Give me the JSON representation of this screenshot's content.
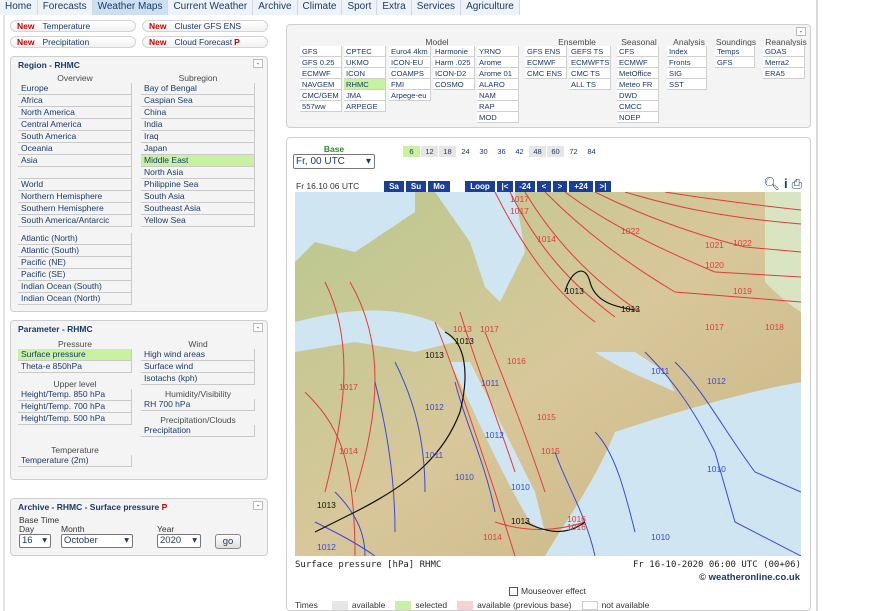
{
  "nav": [
    "Home",
    "Forecasts",
    "Weather Maps",
    "Current Weather",
    "Archive",
    "Climate",
    "Sport",
    "Extra",
    "Services",
    "Agriculture"
  ],
  "quick": [
    {
      "new": "New",
      "label": "Temperature"
    },
    {
      "new": "New",
      "label": "Cluster GFS ENS"
    },
    {
      "new": "New",
      "label": "Precipitation"
    },
    {
      "new": "New",
      "label": "Cloud Forecast",
      "p": "P"
    }
  ],
  "region": {
    "title": "Region - RHMC",
    "overview_title": "Overview",
    "subregion_title": "Subregion",
    "overview": [
      "Europe",
      "Africa",
      "North America",
      "Central America",
      "South America",
      "Oceania",
      "Asia",
      "",
      "World",
      "Northern Hemisphere",
      "Southern Hemisphere",
      "South America/Antarcic"
    ],
    "oceans": [
      "Atlantic (North)",
      "Atlantic (South)",
      "Pacific (NE)",
      "Pacific (SE)",
      "Indian Ocean (South)",
      "Indian Ocean (North)"
    ],
    "subregion": [
      "Bay of Bengal",
      "Caspian Sea",
      "China",
      "India",
      "Iraq",
      "Japan",
      "Middle East",
      "North Asia",
      "Philippine Sea",
      "South Asia",
      "Southeast Asia",
      "Yellow Sea"
    ],
    "selected_sub": "Middle East"
  },
  "parameter": {
    "title": "Parameter - RHMC",
    "pressure_title": "Pressure",
    "pressure": [
      "Surface pressure",
      "Theta-e 850hPa"
    ],
    "upper_title": "Upper level",
    "upper": [
      "Height/Temp. 850 hPa",
      "Height/Temp. 700 hPa",
      "Height/Temp. 500 hPa"
    ],
    "temp_title": "Temperature",
    "temp": [
      "Temperature (2m)"
    ],
    "wind_title": "Wind",
    "wind": [
      "High wind areas",
      "Surface wind",
      "Isotachs (kph)"
    ],
    "hum_title": "Humidity/Visibility",
    "hum": [
      "RH 700 hPa"
    ],
    "precip_title": "Precipitation/Clouds",
    "precip": [
      "Precipitation"
    ]
  },
  "archive": {
    "title": "Archive - RHMC - Surface pressure",
    "p": "P",
    "base_time": "Base Time",
    "day_label": "Day",
    "month_label": "Month",
    "year_label": "Year",
    "day": "16",
    "month": "October",
    "year": "2020",
    "go": "go"
  },
  "models": {
    "model_title": "Model",
    "ensemble_title": "Ensemble",
    "seasonal_title": "Seasonal",
    "analysis_title": "Analysis",
    "soundings_title": "Soundings",
    "reanalysis_title": "Reanalysis",
    "col1": [
      "GFS",
      "GFS 0.25",
      "ECMWF",
      "NAVGEM",
      "CMC/GEM",
      "557ww"
    ],
    "col2": [
      "CPTEC",
      "UKMO",
      "ICON",
      "RHMC",
      "JMA",
      "ARPEGE"
    ],
    "col3": [
      "Euro4 4km",
      "ICON-EU",
      "COAMPS",
      "FMI",
      "Arpege-eu"
    ],
    "col4": [
      "Harmonie",
      "Harm .025",
      "ICON-D2",
      "COSMO"
    ],
    "col5": [
      "YRNO",
      "Arome",
      "Arome 01",
      "ALARO",
      "NAM",
      "RAP",
      "MOD"
    ],
    "ens1": [
      "GFS ENS",
      "ECMWF",
      "CMC ENS"
    ],
    "ens2": [
      "GEFS TS",
      "ECMWFTS",
      "CMC TS",
      "ALL TS"
    ],
    "seasonal": [
      "CFS",
      "ECMWF",
      "MetOffice",
      "Meteo FR",
      "DWD",
      "CMCC",
      "NOEP"
    ],
    "analysis": [
      "Index",
      "Fronts",
      "SIG",
      "SST"
    ],
    "soundings": [
      "Temps",
      "GFS"
    ],
    "reanalysis": [
      "GDAS",
      "Merra2",
      "ERA5"
    ],
    "selected": "RHMC"
  },
  "map": {
    "base_title": "Base",
    "base_value": "Fr, 00 UTC",
    "steps": [
      "6",
      "12",
      "18",
      "24",
      "30",
      "36",
      "42",
      "48",
      "60",
      "72",
      "84"
    ],
    "step_states": [
      "sel",
      "avail",
      "avail",
      "plain",
      "plain",
      "plain",
      "plain",
      "avail",
      "avail",
      "plain",
      "plain"
    ],
    "date": "Fr 16.10 06 UTC",
    "days": [
      "Sa",
      "Su",
      "Mo"
    ],
    "loop": "Loop",
    "nav": [
      "|<",
      "-24",
      "<",
      ">",
      "+24",
      ">|"
    ],
    "caption_left": "Surface pressure [hPa] RHMC",
    "caption_right": "Fr 16-10-2020 06:00 UTC (00+06)",
    "logo": "© weatheronline.co.uk",
    "mouseover": "Mouseover effect",
    "legend_times": "Times",
    "legend": [
      "available",
      "selected",
      "available (previous base)",
      "not available"
    ],
    "isobar_labels": [
      "1017",
      "1017",
      "1014",
      "1013",
      "1013",
      "1013",
      "1017",
      "1016",
      "1013",
      "1017",
      "1014",
      "1012",
      "1011",
      "1011",
      "1015",
      "1016",
      "1015",
      "1010",
      "1010",
      "1013",
      "1013",
      "1012",
      "1014",
      "1016",
      "1022",
      "1022",
      "1021",
      "1020",
      "1019",
      "1018",
      "1017",
      "1011",
      "1012",
      "1010",
      "1010",
      "1013",
      "1012"
    ]
  }
}
